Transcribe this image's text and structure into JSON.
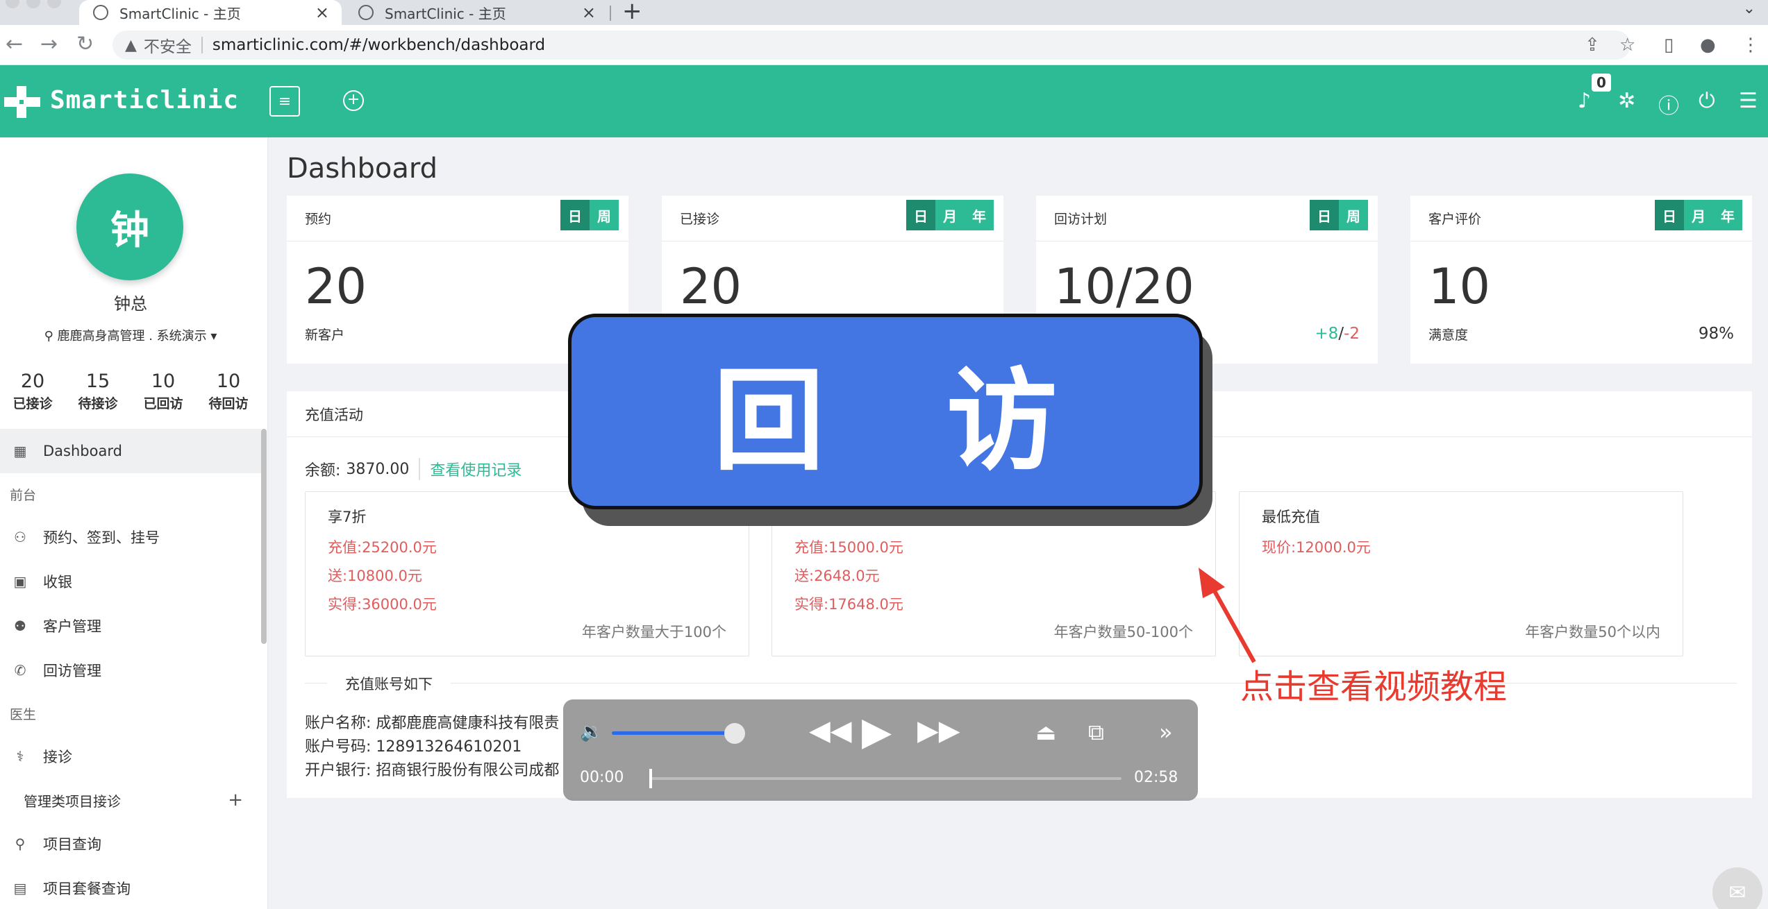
{
  "browser": {
    "tabs": [
      {
        "title": "SmartClinic - 主页"
      },
      {
        "title": "SmartClinic - 主页"
      }
    ],
    "security_label": "不安全",
    "url": "smarticlinic.com/#/workbench/dashboard"
  },
  "header": {
    "logo_text": "Smarticlinic",
    "notification_count": "0"
  },
  "user": {
    "avatar_char": "钟",
    "name": "钟总",
    "org": "鹿鹿高身高管理 . 系统演示",
    "stats": [
      {
        "num": "20",
        "label": "已接诊"
      },
      {
        "num": "15",
        "label": "待接诊"
      },
      {
        "num": "10",
        "label": "已回访"
      },
      {
        "num": "10",
        "label": "待回访"
      }
    ]
  },
  "nav": {
    "dashboard": "Dashboard",
    "group_front": "前台",
    "appointments": "预约、签到、挂号",
    "cashier": "收银",
    "customers": "客户管理",
    "followup": "回访管理",
    "group_doctor": "医生",
    "reception": "接诊",
    "mgmt_reception": "管理类项目接诊",
    "project_query": "项目查询",
    "package_query": "项目套餐查询"
  },
  "main": {
    "title": "Dashboard",
    "cards": [
      {
        "label": "预约",
        "segments": [
          "日",
          "周"
        ],
        "active": 0,
        "value": "20",
        "sub": "新客户"
      },
      {
        "label": "已接诊",
        "segments": [
          "日",
          "月",
          "年"
        ],
        "active": 0,
        "value": "20",
        "sub": ""
      },
      {
        "label": "回访计划",
        "segments": [
          "日",
          "周"
        ],
        "active": 0,
        "value": "10/20",
        "up": "+8",
        "slash": "/",
        "down": "-2"
      },
      {
        "label": "客户评价",
        "segments": [
          "日",
          "月",
          "年"
        ],
        "active": 0,
        "value": "10",
        "sub": "满意度",
        "right": "98%"
      }
    ],
    "recharge": {
      "title": "充值活动",
      "balance_label": "余额:",
      "balance_value": "3870.00",
      "history_link": "查看使用记录",
      "plans": [
        {
          "title": "享7折",
          "lines": [
            "充值:25200.0元",
            "送:10800.0元",
            "实得:36000.0元"
          ],
          "note": "年客户数量大于100个"
        },
        {
          "title": "",
          "lines": [
            "充值:15000.0元",
            "送:2648.0元",
            "实得:17648.0元"
          ],
          "note": "年客户数量50-100个"
        },
        {
          "title": "最低充值",
          "lines": [
            "现价:12000.0元"
          ],
          "note": "年客户数量50个以内"
        }
      ],
      "account_title": "充值账号如下",
      "account_name": "账户名称: 成都鹿鹿高健康科技有限责",
      "account_no": "账户号码: 128913264610201",
      "account_bank": "开户银行: 招商银行股份有限公司成都"
    }
  },
  "overlay": {
    "banner_text": "回 访",
    "hint_text": "点击查看视频教程",
    "player": {
      "current": "00:00",
      "duration": "02:58",
      "volume": 0.9,
      "progress": 0.0
    }
  },
  "colors": {
    "brand": "#2dbb96",
    "banner": "#4376e2",
    "danger": "#e15c5c",
    "hint": "#e83a2e"
  }
}
